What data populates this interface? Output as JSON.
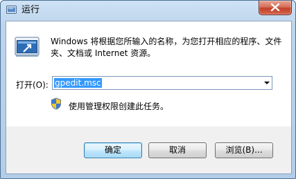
{
  "window": {
    "title": "运行",
    "close_icon": "close-icon",
    "app_icon": "run-app-icon"
  },
  "main": {
    "icon": "run-program-icon",
    "description": "Windows 将根据您所输入的名称，为您打开相应的程序、文件夹、文档或 Internet 资源。",
    "open_label": "打开(O):",
    "input_value": "gpedit.msc",
    "admin_icon": "uac-shield-icon",
    "admin_note": "使用管理权限创建此任务。"
  },
  "buttons": {
    "ok": "确定",
    "cancel": "取消",
    "browse": "浏览(B)..."
  },
  "colors": {
    "selection": "#3399ff",
    "close_button": "#c2402a",
    "title_bar": "#bcd4ec"
  }
}
